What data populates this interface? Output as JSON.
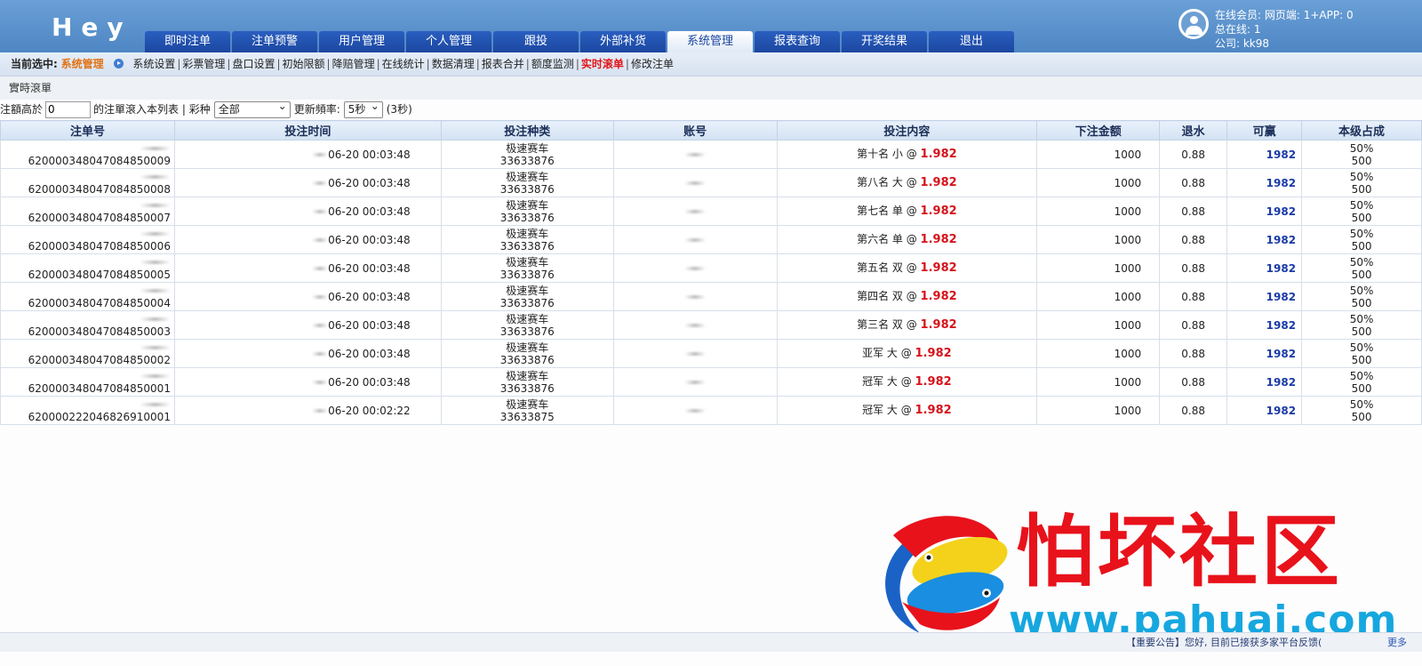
{
  "header": {
    "logo": "Hey",
    "nav": [
      "即时注单",
      "注单预警",
      "用户管理",
      "个人管理",
      "跟投",
      "外部补货",
      "系统管理",
      "报表查询",
      "开奖结果",
      "退出"
    ],
    "active_nav_index": 6,
    "user": {
      "online_members": "在线会员:  网页端:  1+APP:  0",
      "total_online": "总在线:  1",
      "company": "公司:  kk98"
    }
  },
  "subnav": {
    "current_label": "当前选中:",
    "current_value": "系统管理",
    "links": [
      "系统设置",
      "彩票管理",
      "盘口设置",
      "初始限额",
      "降赔管理",
      "在线统计",
      "数据清理",
      "报表合并",
      "额度监测",
      "实时滚单",
      "修改注单"
    ],
    "hot_index": 9
  },
  "section_title": "實時滾單",
  "filter": {
    "label_prefix": "注額高於",
    "amount_value": "0",
    "label_mid": "的注單滾入本列表 | 彩种",
    "lottery_select": "全部",
    "refresh_label": "更新頻率:",
    "refresh_select": "5秒",
    "countdown": "(3秒)"
  },
  "table": {
    "columns": [
      "注单号",
      "投注时间",
      "投注种类",
      "账号",
      "投注内容",
      "下注金额",
      "退水",
      "可赢",
      "本级占成"
    ],
    "rows": [
      {
        "order": "620000348047084850009",
        "time": "06-20 00:03:48",
        "game": "极速赛车",
        "issue": "33633876",
        "content": "第十名 小 @",
        "odds": "1.982",
        "amount": "1000",
        "rebate": "0.88",
        "win": "1982",
        "share_pct": "50%",
        "share_amt": "500"
      },
      {
        "order": "620000348047084850008",
        "time": "06-20 00:03:48",
        "game": "极速赛车",
        "issue": "33633876",
        "content": "第八名 大 @",
        "odds": "1.982",
        "amount": "1000",
        "rebate": "0.88",
        "win": "1982",
        "share_pct": "50%",
        "share_amt": "500"
      },
      {
        "order": "620000348047084850007",
        "time": "06-20 00:03:48",
        "game": "极速赛车",
        "issue": "33633876",
        "content": "第七名 单 @",
        "odds": "1.982",
        "amount": "1000",
        "rebate": "0.88",
        "win": "1982",
        "share_pct": "50%",
        "share_amt": "500"
      },
      {
        "order": "620000348047084850006",
        "time": "06-20 00:03:48",
        "game": "极速赛车",
        "issue": "33633876",
        "content": "第六名 单 @",
        "odds": "1.982",
        "amount": "1000",
        "rebate": "0.88",
        "win": "1982",
        "share_pct": "50%",
        "share_amt": "500"
      },
      {
        "order": "620000348047084850005",
        "time": "06-20 00:03:48",
        "game": "极速赛车",
        "issue": "33633876",
        "content": "第五名 双 @",
        "odds": "1.982",
        "amount": "1000",
        "rebate": "0.88",
        "win": "1982",
        "share_pct": "50%",
        "share_amt": "500"
      },
      {
        "order": "620000348047084850004",
        "time": "06-20 00:03:48",
        "game": "极速赛车",
        "issue": "33633876",
        "content": "第四名 双 @",
        "odds": "1.982",
        "amount": "1000",
        "rebate": "0.88",
        "win": "1982",
        "share_pct": "50%",
        "share_amt": "500"
      },
      {
        "order": "620000348047084850003",
        "time": "06-20 00:03:48",
        "game": "极速赛车",
        "issue": "33633876",
        "content": "第三名 双 @",
        "odds": "1.982",
        "amount": "1000",
        "rebate": "0.88",
        "win": "1982",
        "share_pct": "50%",
        "share_amt": "500"
      },
      {
        "order": "620000348047084850002",
        "time": "06-20 00:03:48",
        "game": "极速赛车",
        "issue": "33633876",
        "content": "亚军 大 @",
        "odds": "1.982",
        "amount": "1000",
        "rebate": "0.88",
        "win": "1982",
        "share_pct": "50%",
        "share_amt": "500"
      },
      {
        "order": "620000348047084850001",
        "time": "06-20 00:03:48",
        "game": "极速赛车",
        "issue": "33633876",
        "content": "冠军 大 @",
        "odds": "1.982",
        "amount": "1000",
        "rebate": "0.88",
        "win": "1982",
        "share_pct": "50%",
        "share_amt": "500"
      },
      {
        "order": "620000222046826910001",
        "time": "06-20 00:02:22",
        "game": "极速赛车",
        "issue": "33633875",
        "content": "冠军 大 @",
        "odds": "1.982",
        "amount": "1000",
        "rebate": "0.88",
        "win": "1982",
        "share_pct": "50%",
        "share_amt": "500"
      }
    ]
  },
  "watermark": {
    "title": "怕坏社区",
    "url": "www.pahuai.com"
  },
  "footer": {
    "notice": "【重要公告】您好, 目前已接获多家平台反馈(",
    "more": "更多"
  },
  "colors": {
    "header_bg": "#5a92cc",
    "nav_tab": "#2052b0",
    "odds_red": "#d5141c",
    "win_blue": "#1a3aa7",
    "hot_link": "#e0161b",
    "current_orange": "#e07316",
    "watermark_red": "#e8121b",
    "watermark_blue": "#16a7df"
  }
}
